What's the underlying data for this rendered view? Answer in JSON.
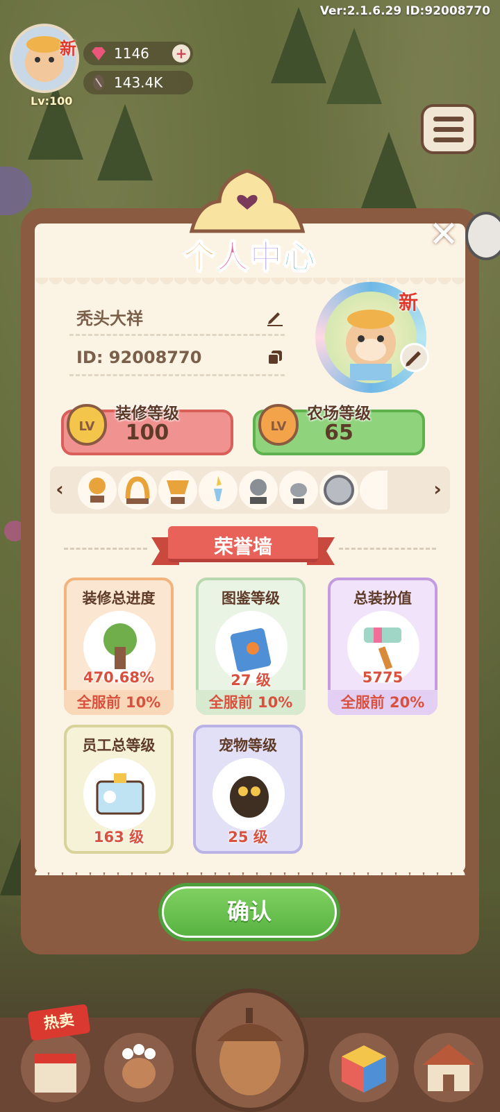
{
  "version_text": "Ver:2.1.6.29 ID:92008770",
  "hud": {
    "level": "Lv:100",
    "new_badge": "新",
    "gems": "1146",
    "seeds": "143.4K"
  },
  "panel": {
    "title_chars": [
      "个",
      "人",
      "中",
      "心"
    ],
    "nickname": "秃头大祥",
    "id_text": "ID: 92008770",
    "avatar_new_badge": "新",
    "decor_level": {
      "label": "装修等级",
      "value": "100"
    },
    "farm_level": {
      "label": "农场等级",
      "value": "65"
    },
    "lv_badge": "LV",
    "honor_wall_title": "荣誉墙",
    "cards": [
      {
        "title": "装修总进度",
        "value": "470.68%",
        "rank": "全服前 10%"
      },
      {
        "title": "图鉴等级",
        "value": "27 级",
        "rank": "全服前 10%"
      },
      {
        "title": "总装扮值",
        "value": "5775",
        "rank": "全服前 20%"
      },
      {
        "title": "员工总等级",
        "value": "163 级"
      },
      {
        "title": "宠物等级",
        "value": "25 级"
      }
    ],
    "confirm_label": "确认"
  },
  "bottom_bar": {
    "hot_sale_label": "热卖"
  },
  "colors": {
    "panel_brown": "#8a5a41",
    "paper": "#fbf3e4",
    "decor_bar": "#f0928f",
    "farm_bar": "#8fd37d",
    "card_orange": "#f3b37c",
    "card_green": "#b9d8b0",
    "card_purple": "#c29be0",
    "card_olive": "#d8d39a",
    "card_blue": "#b9b3e6",
    "confirm_green": "#58b341"
  }
}
